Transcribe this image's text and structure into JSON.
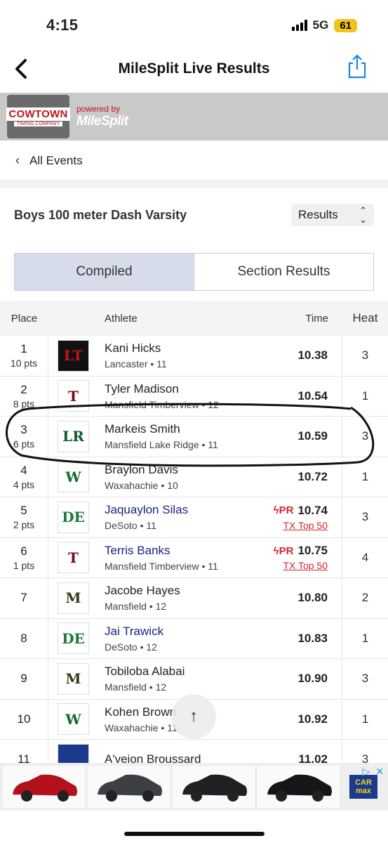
{
  "status": {
    "time": "4:15",
    "network": "5G",
    "battery": "61"
  },
  "nav": {
    "title": "MileSplit Live Results"
  },
  "banner": {
    "logo_main": "COWTOWN",
    "logo_sub": "TIMING COMPANY",
    "powered_by": "powered by",
    "brand": "MileSplit"
  },
  "all_events_label": "All Events",
  "event": {
    "title": "Boys 100 meter Dash Varsity",
    "view_select": "Results"
  },
  "tabs": [
    {
      "label": "Compiled"
    },
    {
      "label": "Section Results"
    }
  ],
  "table": {
    "headers": {
      "place": "Place",
      "athlete": "Athlete",
      "time": "Time",
      "heat": "Heat"
    },
    "rows": [
      {
        "place": "1",
        "pts": "10 pts",
        "name": "Kani Hicks",
        "team": "Lancaster • 11",
        "time": "10.38",
        "heat": "3",
        "logo": "LT",
        "logo_color": "#c0141c",
        "logo_bg": "#111111"
      },
      {
        "place": "2",
        "pts": "8 pts",
        "name": "Tyler Madison",
        "team": "Mansfield Timberview • 12",
        "time": "10.54",
        "heat": "1",
        "logo": "T",
        "logo_color": "#7a0a12",
        "logo_bg": "#ffffff"
      },
      {
        "place": "3",
        "pts": "6 pts",
        "name": "Markeis Smith",
        "team": "Mansfield Lake Ridge • 11",
        "time": "10.59",
        "heat": "3",
        "logo": "LR",
        "logo_color": "#0d5c2c",
        "logo_bg": "#ffffff"
      },
      {
        "place": "4",
        "pts": "4 pts",
        "name": "Braylon Davis",
        "team": "Waxahachie • 10",
        "time": "10.72",
        "heat": "1",
        "logo": "W",
        "logo_color": "#1a6b2e",
        "logo_bg": "#ffffff"
      },
      {
        "place": "5",
        "pts": "2 pts",
        "name": "Jaquaylon Silas",
        "team": "DeSoto • 11",
        "time": "10.74",
        "heat": "3",
        "logo": "DE",
        "logo_color": "#1d7a3a",
        "logo_bg": "#ffffff",
        "pr": "PR",
        "tx_top": "TX Top 50",
        "link": true
      },
      {
        "place": "6",
        "pts": "1 pts",
        "name": "Terris Banks",
        "team": "Mansfield Timberview • 11",
        "time": "10.75",
        "heat": "4",
        "logo": "T",
        "logo_color": "#7a0a12",
        "logo_bg": "#ffffff",
        "pr": "PR",
        "tx_top": "TX Top 50",
        "link": true
      },
      {
        "place": "7",
        "pts": "",
        "name": "Jacobe Hayes",
        "team": "Mansfield • 12",
        "time": "10.80",
        "heat": "2",
        "logo": "M",
        "logo_color": "#3a3a1a",
        "logo_bg": "#ffffff"
      },
      {
        "place": "8",
        "pts": "",
        "name": "Jai Trawick",
        "team": "DeSoto • 12",
        "time": "10.83",
        "heat": "1",
        "logo": "DE",
        "logo_color": "#1d7a3a",
        "logo_bg": "#ffffff",
        "link": true
      },
      {
        "place": "9",
        "pts": "",
        "name": "Tobiloba Alabai",
        "team": "Mansfield • 12",
        "time": "10.90",
        "heat": "3",
        "logo": "M",
        "logo_color": "#3a3a1a",
        "logo_bg": "#ffffff"
      },
      {
        "place": "10",
        "pts": "",
        "name": "Kohen Brown",
        "team": "Waxahachie • 11",
        "time": "10.92",
        "heat": "1",
        "logo": "W",
        "logo_color": "#1a6b2e",
        "logo_bg": "#ffffff"
      },
      {
        "place": "11",
        "pts": "",
        "name": "A'veion Broussard",
        "team": "",
        "time": "11.02",
        "heat": "3",
        "logo": "",
        "logo_color": "#1c3a8c",
        "logo_bg": "#1c3a8c"
      }
    ]
  },
  "ad": {
    "brand_line1": "CAR",
    "brand_line2": "max",
    "cars": [
      "red-suv",
      "gray-suv",
      "black-suv",
      "black-suv-2"
    ]
  }
}
